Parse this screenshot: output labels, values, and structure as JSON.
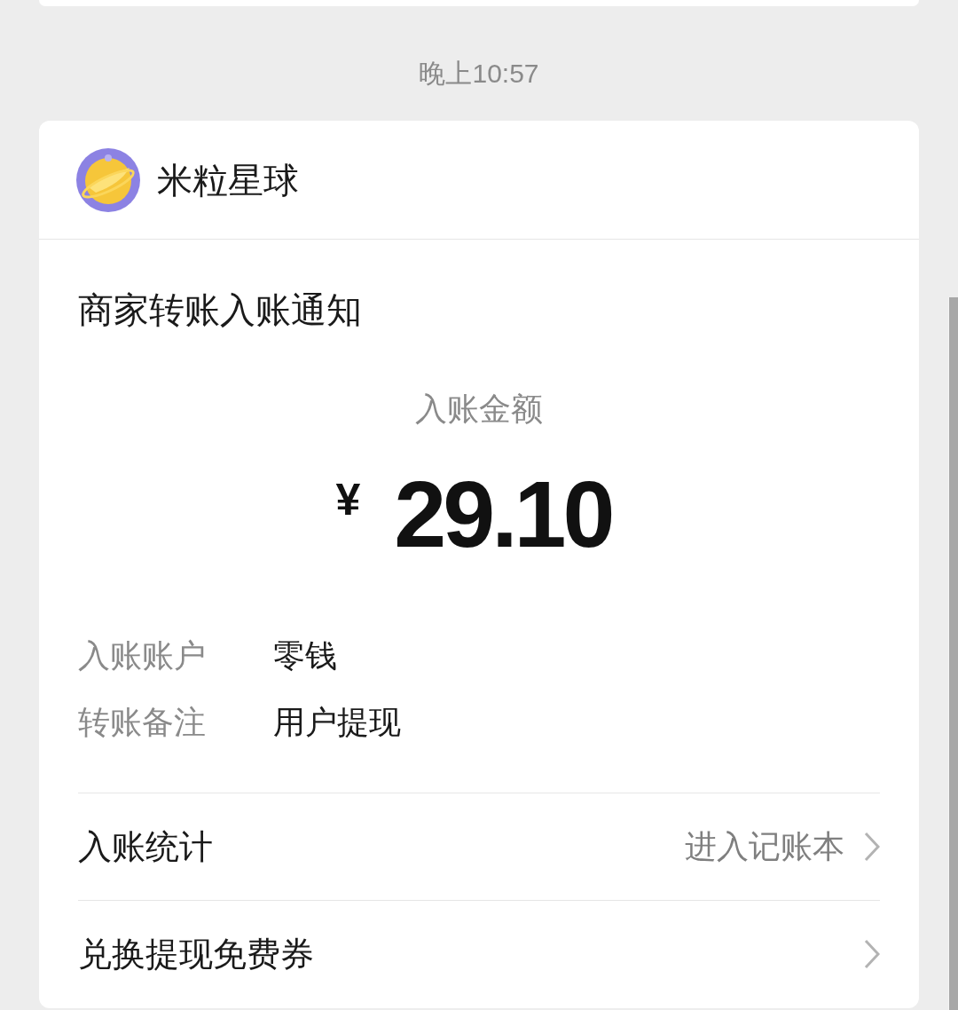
{
  "timestamp": "晚上10:57",
  "notification": {
    "app": {
      "name": "米粒星球"
    },
    "title": "商家转账入账通知",
    "amount": {
      "label": "入账金额",
      "currency": "¥",
      "value": "29.10"
    },
    "details": [
      {
        "label": "入账账户",
        "value": "零钱"
      },
      {
        "label": "转账备注",
        "value": "用户提现"
      }
    ],
    "links": [
      {
        "label": "入账统计",
        "action": "进入记账本"
      },
      {
        "label": "兑换提现免费券"
      }
    ]
  }
}
